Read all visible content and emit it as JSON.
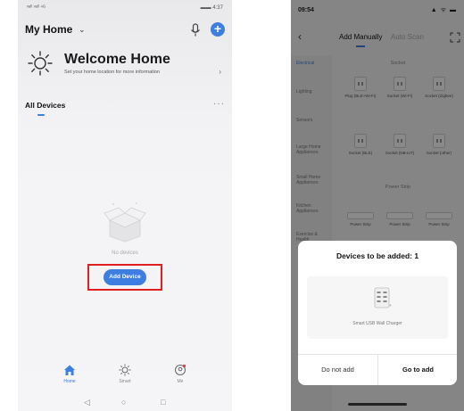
{
  "left": {
    "status": {
      "signal": "ᵛᵃˡˡ ᵛᵃˡˡ ⁴ᴳ",
      "battery": "▬▬ 4:37"
    },
    "header": {
      "title": "My Home",
      "caret": "⌄"
    },
    "welcome": {
      "title": "Welcome Home",
      "subtitle": "Set your home location for more information",
      "chevron": "›"
    },
    "devices": {
      "label": "All Devices",
      "more": "···",
      "empty_text": "No devices",
      "add_button": "Add Device"
    },
    "tabs": [
      {
        "label": "Home",
        "icon": "home-icon",
        "active": true
      },
      {
        "label": "Smart",
        "icon": "sun-icon",
        "active": false
      },
      {
        "label": "Me",
        "icon": "user-icon",
        "active": false
      }
    ],
    "nav": {
      "back": "◁",
      "home": "○",
      "recents": "□"
    },
    "colors": {
      "accent": "#3d7ee0",
      "highlight": "#e02020"
    }
  },
  "right": {
    "status": {
      "time": "09:54",
      "icons": "▲ ᯤ ▬"
    },
    "nav": {
      "back": "‹",
      "tab_manual": "Add Manually",
      "tab_auto": "Auto Scan"
    },
    "categories": [
      "Electrical",
      "Lighting",
      "Sensors",
      "Large Home Appliances",
      "Small Home Appliances",
      "Kitchen Appliances",
      "Exercise & Health"
    ],
    "sections": {
      "socket": "Socket",
      "power_strip": "Power Strip"
    },
    "socket_devices": [
      {
        "name": "Plug (BLE+Wi-Fi)"
      },
      {
        "name": "Socket (Wi-Fi)"
      },
      {
        "name": "Socket (Zigbee)"
      },
      {
        "name": "Socket (BLE)"
      },
      {
        "name": "Socket (NB-IoT)"
      },
      {
        "name": "Socket (other)"
      }
    ],
    "strip_devices": [
      {
        "name": "Power Strip"
      },
      {
        "name": "Power Strip"
      },
      {
        "name": "Power Strip"
      }
    ],
    "dialog": {
      "title": "Devices to be added: 1",
      "device_name": "Smart USB Wall Charger",
      "cancel": "Do not add",
      "confirm": "Go to add"
    }
  }
}
